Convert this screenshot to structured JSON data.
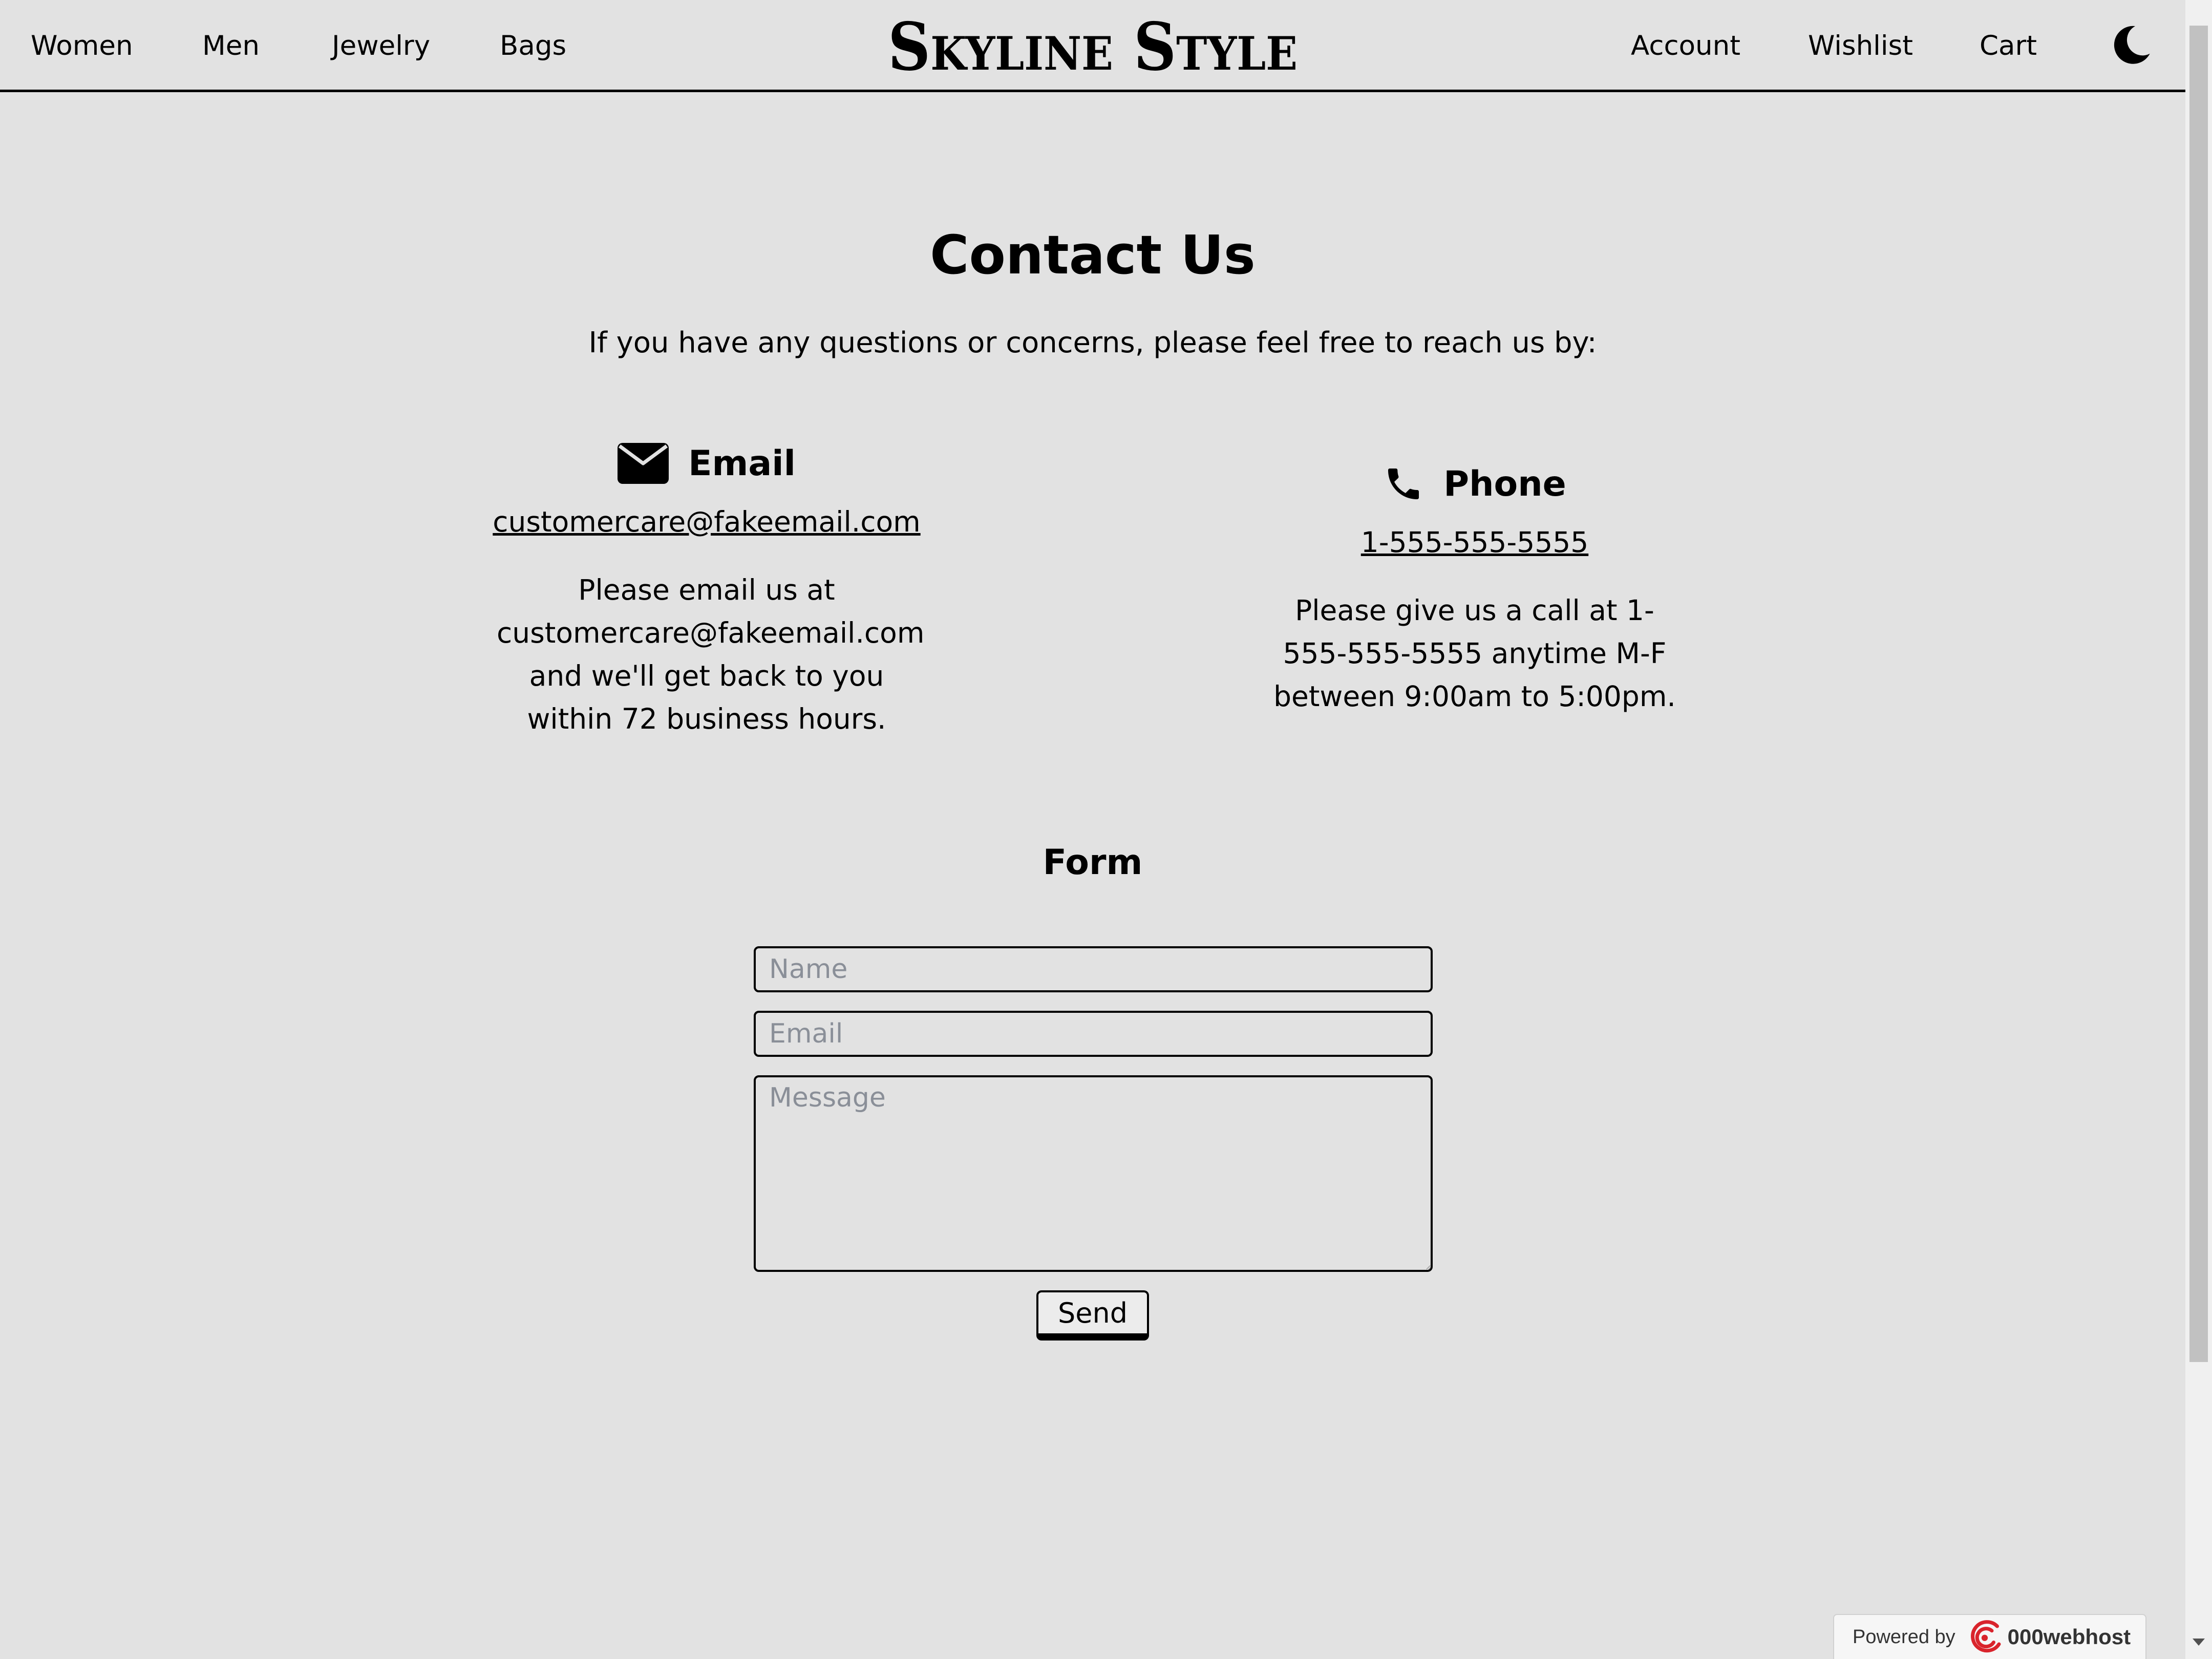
{
  "header": {
    "nav_left": [
      {
        "label": "Women"
      },
      {
        "label": "Men"
      },
      {
        "label": "Jewelry"
      },
      {
        "label": "Bags"
      }
    ],
    "logo": "Skyline Style",
    "nav_right": [
      {
        "label": "Account"
      },
      {
        "label": "Wishlist"
      },
      {
        "label": "Cart"
      }
    ],
    "theme_toggle_icon": "moon-icon"
  },
  "main": {
    "title": "Contact Us",
    "intro": "If you have any questions or concerns, please feel free to reach us by:",
    "email": {
      "icon": "envelope-icon",
      "heading": "Email",
      "link": "customercare@fakeemail.com",
      "text": "Please email us at customercare@fakeemail.com and we'll get back to you within 72 business hours."
    },
    "phone": {
      "icon": "phone-icon",
      "heading": "Phone",
      "link": "1-555-555-5555",
      "text": "Please give us a call at 1-555-555-5555 anytime M-F between 9:00am to 5:00pm."
    },
    "form": {
      "title": "Form",
      "name_placeholder": "Name",
      "email_placeholder": "Email",
      "message_placeholder": "Message",
      "send_label": "Send"
    }
  },
  "footer_badge": {
    "powered_by": "Powered by",
    "brand": "000webhost",
    "icon": "000webhost-logo-icon"
  },
  "colors": {
    "background": "#e2e2e2",
    "text": "#000000",
    "placeholder": "#8a8f98"
  }
}
